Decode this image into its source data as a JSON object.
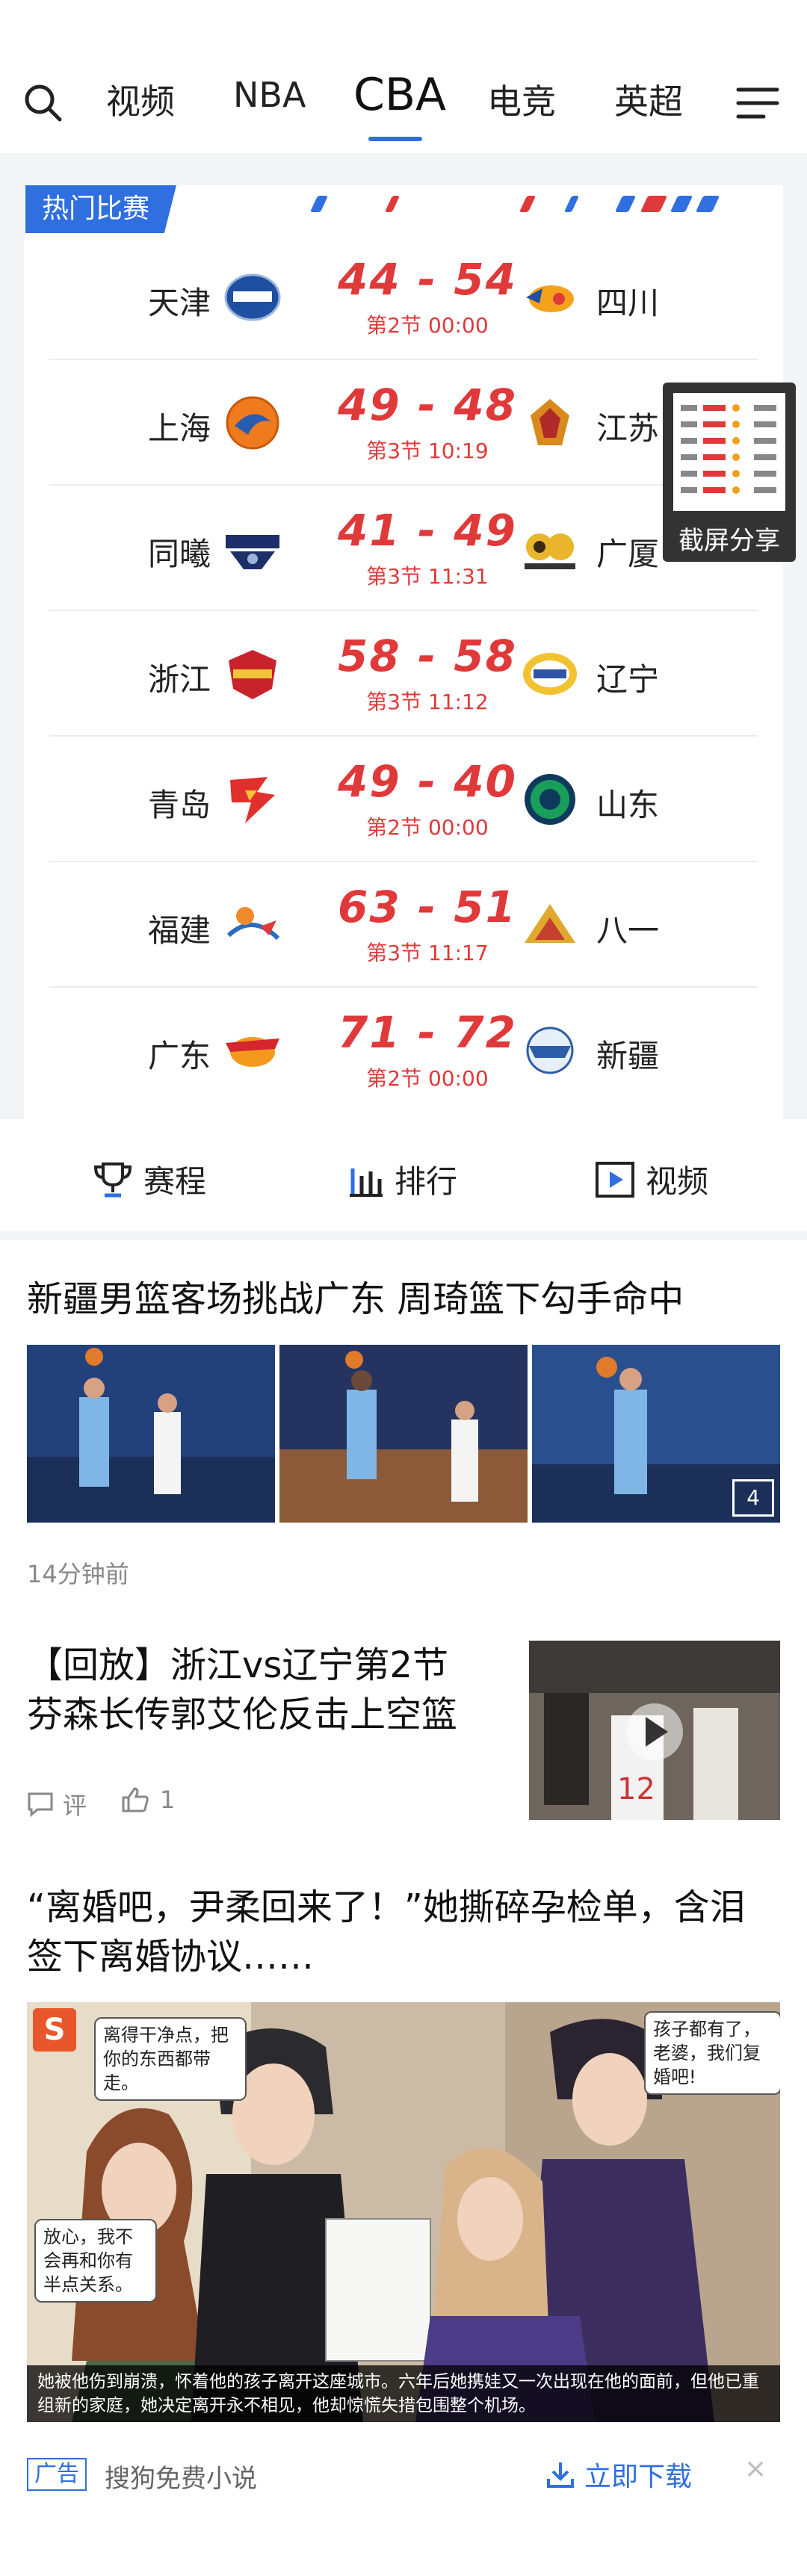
{
  "nav": {
    "tabs": [
      {
        "label": "视频"
      },
      {
        "label": "NBA"
      },
      {
        "label": "CBA"
      },
      {
        "label": "电竞"
      },
      {
        "label": "英超"
      }
    ],
    "active": "CBA",
    "search_icon": "search-icon",
    "menu_icon": "menu-icon"
  },
  "hot": {
    "title": "热门比赛",
    "games": [
      {
        "home": "天津",
        "away": "四川",
        "score": "44 - 54",
        "period": "第2节 00:00"
      },
      {
        "home": "上海",
        "away": "江苏",
        "score": "49 - 48",
        "period": "第3节 10:19"
      },
      {
        "home": "同曦",
        "away": "广厦",
        "score": "41 - 49",
        "period": "第3节 11:31"
      },
      {
        "home": "浙江",
        "away": "辽宁",
        "score": "58 - 58",
        "period": "第3节 11:12"
      },
      {
        "home": "青岛",
        "away": "山东",
        "score": "49 - 40",
        "period": "第2节 00:00"
      },
      {
        "home": "福建",
        "away": "八一",
        "score": "63 - 51",
        "period": "第3节 11:17"
      },
      {
        "home": "广东",
        "away": "新疆",
        "score": "71 - 72",
        "period": "第2节 00:00"
      }
    ]
  },
  "share": {
    "label": "截屏分享"
  },
  "shortcuts": [
    {
      "label": "赛程",
      "icon": "trophy-icon"
    },
    {
      "label": "排行",
      "icon": "bar-chart-icon"
    },
    {
      "label": "视频",
      "icon": "play-icon"
    }
  ],
  "feed": {
    "article1": {
      "title": "新疆男篮客场挑战广东 周琦篮下勾手命中",
      "time": "14分钟前",
      "photo_count": "4"
    },
    "article2": {
      "title_line1": "【回放】浙江vs辽宁第2节",
      "title_line2": "芬森长传郭艾伦反击上空篮",
      "comment_label": "评",
      "like_count": "1",
      "jersey": "12"
    },
    "ad": {
      "title_line1": "“离婚吧，尹柔回来了！”她撕碎孕检单，含泪",
      "title_line2": "签下离婚协议……",
      "bubble1": "离得干净点，把你的东西都带走。",
      "bubble2": "孩子都有了，老婆，我们复婚吧!",
      "bubble3": "放心，我不会再和你有半点关系。",
      "caption": "她被他伤到崩溃，怀着他的孩子离开这座城市。六年后她携娃又一次出现在他的面前，但他已重组新的家庭，她决定离开永不相见，他却惊慌失措包围整个机场。",
      "badge": "S",
      "tag": "广告",
      "source": "搜狗免费小说",
      "download": "立即下载",
      "close": "×"
    }
  },
  "colors": {
    "accent": "#2f6fe0",
    "score": "#e0393a"
  }
}
